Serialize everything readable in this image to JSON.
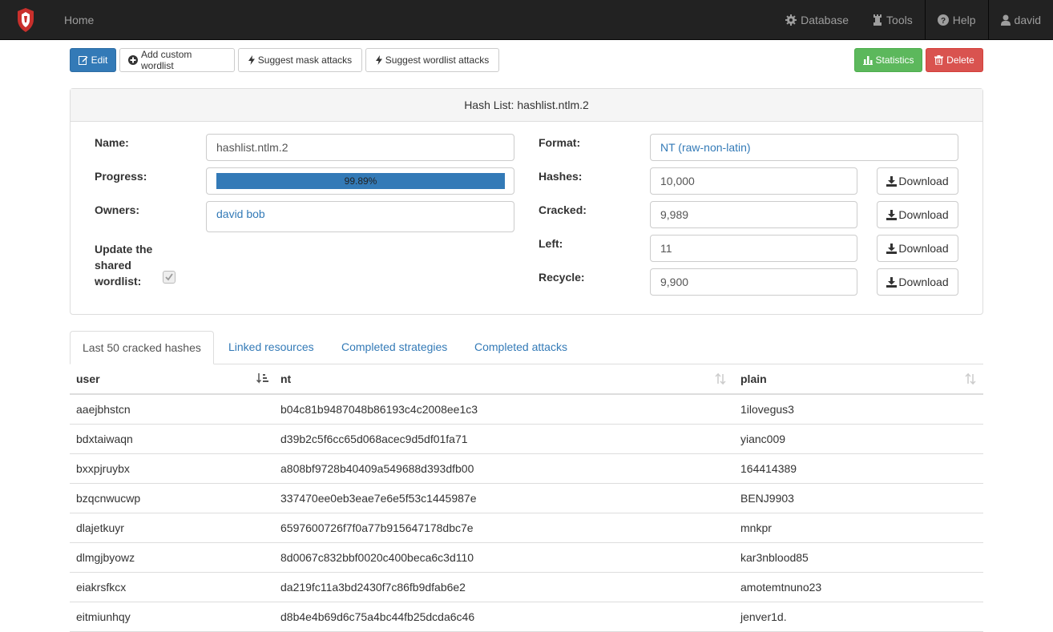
{
  "navbar": {
    "home": "Home",
    "database": "Database",
    "tools": "Tools",
    "help": "Help",
    "user": "david"
  },
  "toolbar": {
    "edit": "Edit",
    "add_wordlist": "Add custom wordlist",
    "suggest_mask": "Suggest mask attacks",
    "suggest_wordlist": "Suggest wordlist attacks",
    "statistics": "Statistics",
    "delete": "Delete"
  },
  "panel": {
    "title": "Hash List: hashlist.ntlm.2",
    "name_label": "Name:",
    "name_value": "hashlist.ntlm.2",
    "progress_label": "Progress:",
    "progress_text": "99.89%",
    "progress_value": 0.9989,
    "owners_label": "Owners:",
    "owners_value": "david bob",
    "update_label_1": "Update the",
    "update_label_2": "shared",
    "update_label_3": "wordlist:",
    "update_checked": true,
    "format_label": "Format:",
    "format_value": "NT (raw-non-latin)",
    "hashes_label": "Hashes:",
    "hashes_value": "10,000",
    "cracked_label": "Cracked:",
    "cracked_value": "9,989",
    "left_label": "Left:",
    "left_value": "11",
    "recycle_label": "Recycle:",
    "recycle_value": "9,900",
    "download_label": "Download"
  },
  "tabs": [
    "Last 50 cracked hashes",
    "Linked resources",
    "Completed strategies",
    "Completed attacks"
  ],
  "table": {
    "columns": [
      "user",
      "nt",
      "plain"
    ],
    "rows": [
      [
        "aaejbhstcn",
        "b04c81b9487048b86193c4c2008ee1c3",
        "1ilovegus3"
      ],
      [
        "bdxtaiwaqn",
        "d39b2c5f6cc65d068acec9d5df01fa71",
        "yianc009"
      ],
      [
        "bxxpjruybx",
        "a808bf9728b40409a549688d393dfb00",
        "164414389"
      ],
      [
        "bzqcnwucwp",
        "337470ee0eb3eae7e6e5f53c1445987e",
        "BENJ9903"
      ],
      [
        "dlajetkuyr",
        "6597600726f7f0a77b915647178dbc7e",
        "mnkpr"
      ],
      [
        "dlmgjbyowz",
        "8d0067c832bbf0020c400beca6c3d110",
        "kar3nblood85"
      ],
      [
        "eiakrsfkcx",
        "da219fc11a3bd2430f7c86fb9dfab6e2",
        "amotemtnuno23"
      ],
      [
        "eitmiunhqy",
        "d8b4e4b69d6c75a4bc44fb25dcda6c46",
        "jenver1d."
      ]
    ]
  }
}
